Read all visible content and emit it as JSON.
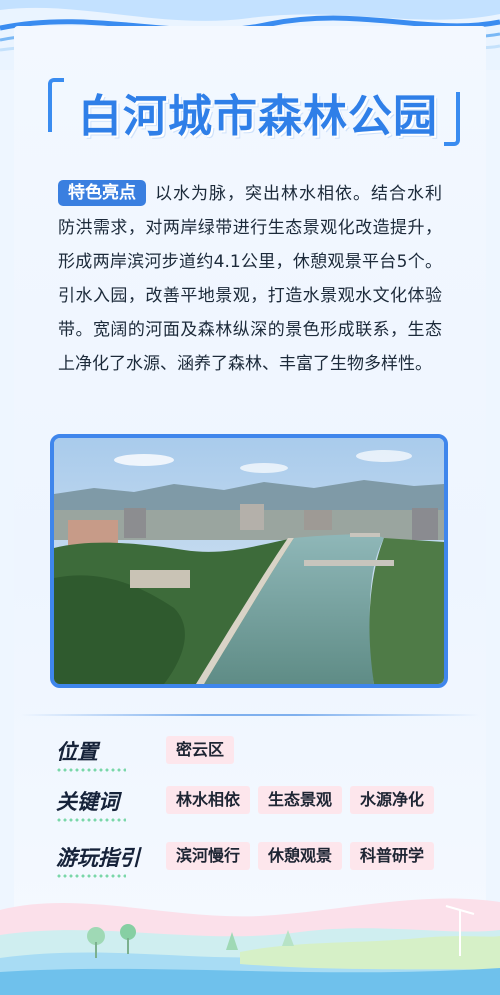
{
  "title": "白河城市森林公园",
  "highlight": {
    "tag": "特色亮点",
    "text": "以水为脉，突出林水相依。结合水利防洪需求，对两岸绿带进行生态景观化改造提升，形成两岸滨河步道约4.1公里，休憩观景平台5个。引水入园，改善平地景观，打造水景观水文化体验带。宽阔的河面及森林纵深的景色形成联系，生态上净化了水源、涵养了森林、丰富了生物多样性。"
  },
  "info": {
    "location": {
      "label": "位置",
      "values": [
        "密云区"
      ]
    },
    "keywords": {
      "label": "关键词",
      "values": [
        "林水相依",
        "生态景观",
        "水源净化"
      ]
    },
    "guide": {
      "label": "游玩指引",
      "values": [
        "滨河慢行",
        "休憩观景",
        "科普研学"
      ]
    }
  },
  "colors": {
    "accent": "#2f7fe8",
    "tag_bg": "#3a7fe0",
    "pill_bg": "#fde6ec",
    "frame": "#3f86ec"
  }
}
